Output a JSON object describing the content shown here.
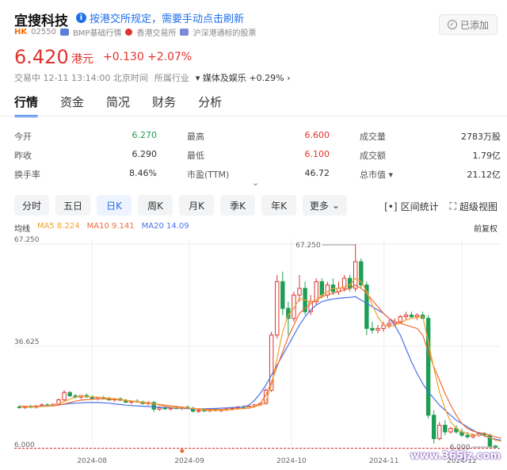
{
  "header": {
    "stock_name": "宜搜科技",
    "notice": "按港交所规定，需要手动点击刷新",
    "added_label": "已添加",
    "market": "HK",
    "code": "02550",
    "source_bmp": "BMP基础行情",
    "exchange": "香港交易所",
    "connect": "沪深港通标的股票"
  },
  "quote": {
    "price": "6.420",
    "unit": "港元",
    "change": "+0.130",
    "change_pct": "+2.07%",
    "status": "交易中 12-11 13:14:00 北京时间",
    "industry_label": "所属行业",
    "industry_name": "媒体及娱乐",
    "industry_change": "+0.29%"
  },
  "tabs": [
    "行情",
    "资金",
    "简况",
    "财务",
    "分析"
  ],
  "stats": [
    [
      {
        "label": "今开",
        "value": "6.270",
        "color": "green"
      },
      {
        "label": "最高",
        "value": "6.600",
        "color": "red"
      },
      {
        "label": "成交量",
        "value": "2783万股",
        "color": ""
      }
    ],
    [
      {
        "label": "昨收",
        "value": "6.290",
        "color": ""
      },
      {
        "label": "最低",
        "value": "6.100",
        "color": "red"
      },
      {
        "label": "成交额",
        "value": "1.79亿",
        "color": ""
      }
    ],
    [
      {
        "label": "换手率",
        "value": "8.46%",
        "color": ""
      },
      {
        "label": "市盈(TTM)",
        "value": "46.72",
        "color": ""
      },
      {
        "label": "总市值",
        "value": "21.12亿",
        "color": ""
      }
    ]
  ],
  "periods": [
    "分时",
    "五日",
    "日K",
    "周K",
    "月K",
    "季K",
    "年K",
    "更多"
  ],
  "active_period": "日K",
  "tools": {
    "range": "区间统计",
    "fullscreen": "超级视图"
  },
  "ma": {
    "label": "均线",
    "ma5": "MA5 8.224",
    "ma10": "MA10 9.141",
    "ma20": "MA20 14.09",
    "adjust": "前复权"
  },
  "colors": {
    "up": "#e0332c",
    "down": "#1e9e55",
    "ma5": "#f2a12e",
    "ma10": "#f06a3a",
    "ma20": "#4a72e8",
    "accent": "#1f6feb"
  },
  "watermark": "www.365jz.com",
  "chart_data": {
    "type": "candlestick",
    "y_ticks": [
      "67.250",
      "36.625",
      "6.000"
    ],
    "ylim": [
      6.0,
      67.25
    ],
    "x_ticks": [
      "2024-08",
      "2024-09",
      "2024-10",
      "2024-11",
      "2024-12"
    ],
    "high_label": "67.250",
    "low_label": "6.000",
    "candles": [
      [
        18.5,
        19.0,
        18.0,
        18.3
      ],
      [
        18.3,
        18.8,
        17.9,
        18.6
      ],
      [
        18.6,
        19.2,
        18.2,
        18.4
      ],
      [
        18.4,
        18.9,
        18.0,
        18.8
      ],
      [
        18.8,
        19.5,
        18.5,
        19.1
      ],
      [
        19.1,
        19.6,
        18.7,
        18.9
      ],
      [
        18.9,
        19.4,
        18.6,
        19.3
      ],
      [
        19.3,
        21.0,
        19.0,
        20.6
      ],
      [
        20.6,
        23.5,
        20.2,
        22.8
      ],
      [
        22.8,
        23.2,
        21.5,
        21.8
      ],
      [
        21.8,
        22.4,
        21.0,
        21.4
      ],
      [
        21.4,
        22.0,
        20.8,
        21.9
      ],
      [
        21.9,
        22.5,
        21.2,
        21.5
      ],
      [
        21.5,
        22.0,
        20.6,
        20.9
      ],
      [
        20.9,
        21.6,
        20.4,
        21.3
      ],
      [
        21.3,
        21.8,
        20.7,
        21.0
      ],
      [
        21.0,
        21.5,
        20.3,
        20.6
      ],
      [
        20.6,
        21.2,
        20.0,
        20.9
      ],
      [
        20.9,
        21.4,
        20.2,
        20.5
      ],
      [
        20.5,
        20.9,
        19.6,
        19.9
      ],
      [
        19.9,
        20.5,
        19.3,
        20.2
      ],
      [
        20.2,
        20.8,
        19.7,
        20.0
      ],
      [
        20.0,
        20.4,
        19.2,
        19.5
      ],
      [
        19.5,
        20.1,
        18.9,
        19.8
      ],
      [
        19.8,
        20.3,
        17.0,
        17.8
      ],
      [
        17.8,
        18.6,
        17.3,
        18.2
      ],
      [
        18.2,
        18.7,
        17.6,
        17.9
      ],
      [
        17.9,
        18.5,
        17.4,
        18.3
      ],
      [
        18.3,
        18.8,
        17.7,
        18.0
      ],
      [
        18.0,
        18.6,
        17.5,
        18.4
      ],
      [
        18.4,
        18.9,
        17.8,
        18.1
      ],
      [
        18.1,
        18.5,
        16.8,
        17.2
      ],
      [
        17.2,
        17.8,
        16.6,
        17.5
      ],
      [
        17.5,
        18.1,
        17.0,
        17.3
      ],
      [
        17.3,
        17.9,
        16.9,
        17.7
      ],
      [
        17.7,
        18.2,
        17.1,
        17.4
      ],
      [
        17.4,
        17.9,
        16.9,
        17.6
      ],
      [
        17.6,
        18.1,
        17.2,
        17.9
      ],
      [
        17.9,
        18.4,
        17.4,
        18.1
      ],
      [
        18.1,
        18.7,
        17.7,
        18.5
      ],
      [
        18.5,
        19.0,
        18.0,
        18.3
      ],
      [
        18.3,
        18.9,
        17.9,
        18.7
      ],
      [
        18.7,
        19.3,
        18.3,
        19.1
      ],
      [
        19.1,
        19.8,
        18.8,
        19.5
      ],
      [
        19.5,
        24.0,
        19.2,
        23.5
      ],
      [
        23.5,
        41.0,
        23.0,
        40.0
      ],
      [
        40.0,
        58.0,
        39.0,
        56.0
      ],
      [
        56.0,
        59.0,
        46.0,
        48.0
      ],
      [
        48.0,
        50.0,
        40.0,
        45.0
      ],
      [
        45.0,
        53.0,
        44.0,
        52.0
      ],
      [
        52.0,
        58.0,
        50.0,
        54.0
      ],
      [
        54.0,
        56.0,
        46.0,
        47.0
      ],
      [
        47.0,
        52.0,
        46.0,
        50.0
      ],
      [
        50.0,
        57.0,
        49.0,
        56.0
      ],
      [
        56.0,
        57.0,
        51.0,
        52.0
      ],
      [
        52.0,
        56.0,
        51.0,
        55.0
      ],
      [
        55.0,
        57.0,
        52.0,
        53.0
      ],
      [
        53.0,
        56.0,
        52.0,
        54.0
      ],
      [
        54.0,
        58.0,
        53.0,
        57.0
      ],
      [
        57.0,
        58.0,
        53.0,
        54.0
      ],
      [
        54.0,
        67.25,
        53.0,
        62.0
      ],
      [
        62.0,
        63.0,
        54.0,
        55.0
      ],
      [
        55.0,
        56.0,
        40.0,
        42.0
      ],
      [
        42.0,
        44.0,
        40.5,
        41.5
      ],
      [
        41.5,
        43.0,
        40.5,
        42.0
      ],
      [
        42.0,
        44.0,
        41.0,
        43.0
      ],
      [
        43.0,
        44.5,
        42.0,
        43.5
      ],
      [
        43.5,
        45.0,
        42.5,
        44.0
      ],
      [
        44.0,
        46.0,
        43.5,
        45.5
      ],
      [
        45.5,
        47.0,
        44.5,
        46.0
      ],
      [
        46.0,
        47.0,
        45.0,
        45.5
      ],
      [
        45.5,
        46.5,
        44.5,
        46.0
      ],
      [
        46.0,
        47.0,
        45.0,
        45.0
      ],
      [
        45.0,
        46.0,
        15.0,
        16.0
      ],
      [
        16.0,
        17.5,
        7.5,
        9.0
      ],
      [
        9.0,
        14.0,
        8.5,
        13.0
      ],
      [
        13.0,
        14.5,
        10.0,
        11.0
      ],
      [
        11.0,
        12.5,
        10.5,
        12.0
      ],
      [
        12.0,
        13.0,
        10.5,
        11.0
      ],
      [
        11.0,
        12.0,
        9.5,
        10.0
      ],
      [
        10.0,
        11.0,
        9.0,
        9.5
      ],
      [
        9.5,
        10.5,
        9.0,
        10.0
      ],
      [
        10.0,
        11.0,
        9.5,
        10.5
      ],
      [
        10.5,
        11.0,
        9.5,
        10.0
      ],
      [
        10.0,
        10.5,
        6.2,
        6.8
      ],
      [
        6.8,
        7.0,
        6.0,
        6.42
      ]
    ],
    "ma20_line": [
      18.6,
      18.6,
      18.6,
      18.6,
      18.7,
      18.8,
      18.9,
      19.1,
      19.3,
      19.5,
      19.6,
      19.7,
      19.8,
      19.8,
      19.8,
      19.7,
      19.6,
      19.4,
      19.2,
      19.0,
      18.9,
      18.8,
      18.7,
      18.6,
      18.5,
      18.4,
      18.3,
      18.2,
      18.1,
      18.0,
      18.0,
      17.9,
      17.9,
      17.9,
      18.0,
      18.0,
      18.1,
      18.2,
      18.3,
      18.4,
      18.5,
      19.0,
      20.5,
      22.5,
      25.0,
      28.0,
      31.0,
      34.0,
      37.0,
      40.0,
      43.0,
      45.5,
      47.5,
      49.0,
      50.0,
      50.5,
      50.8,
      51.0,
      51.2,
      51.3,
      51.5,
      50.5,
      49.5,
      48.5,
      47.5,
      46.5,
      45.0,
      43.0,
      40.0,
      36.0,
      32.0,
      28.5,
      25.5,
      23.0,
      21.0,
      19.0,
      17.5,
      16.0,
      14.5,
      13.5,
      12.5,
      11.5,
      10.6,
      9.8,
      9.2,
      8.8,
      8.5
    ],
    "ma5_line": [
      18.6,
      18.5,
      18.5,
      18.5,
      18.6,
      18.8,
      18.9,
      19.4,
      20.1,
      20.8,
      21.4,
      21.8,
      21.6,
      21.5,
      21.4,
      21.3,
      21.1,
      20.9,
      20.7,
      20.5,
      20.3,
      20.1,
      19.9,
      19.7,
      19.4,
      19.0,
      18.7,
      18.4,
      18.2,
      18.1,
      18.2,
      18.0,
      17.8,
      17.6,
      17.4,
      17.4,
      17.5,
      17.6,
      17.7,
      17.9,
      18.1,
      18.3,
      18.6,
      19.0,
      20.0,
      25.0,
      33.0,
      41.0,
      46.0,
      48.0,
      51.0,
      50.5,
      50.0,
      50.5,
      52.0,
      53.0,
      54.0,
      54.0,
      54.5,
      55.0,
      57.0,
      56.0,
      53.0,
      49.0,
      45.5,
      43.0,
      42.5,
      43.0,
      43.5,
      44.5,
      45.0,
      45.3,
      45.6,
      38.0,
      30.0,
      23.0,
      18.0,
      14.0,
      12.0,
      11.0,
      10.5,
      10.2,
      10.0,
      10.0,
      9.3,
      8.5,
      8.2
    ],
    "ma10_line": [
      18.7,
      18.7,
      18.6,
      18.6,
      18.6,
      18.7,
      18.8,
      19.0,
      19.4,
      19.8,
      20.2,
      20.5,
      20.7,
      20.8,
      20.9,
      20.9,
      20.8,
      20.7,
      20.6,
      20.4,
      20.2,
      20.0,
      19.8,
      19.6,
      19.4,
      19.2,
      19.0,
      18.8,
      18.6,
      18.4,
      18.2,
      18.0,
      17.9,
      17.8,
      17.7,
      17.7,
      17.7,
      17.8,
      17.8,
      17.9,
      18.0,
      18.2,
      18.5,
      19.5,
      22.0,
      26.0,
      30.5,
      35.0,
      39.5,
      43.0,
      46.5,
      48.0,
      49.5,
      50.5,
      51.5,
      52.0,
      52.5,
      53.0,
      53.5,
      54.0,
      55.0,
      54.0,
      52.5,
      50.5,
      48.5,
      46.5,
      45.0,
      44.0,
      43.5,
      43.0,
      42.5,
      42.0,
      40.0,
      35.0,
      30.5,
      26.5,
      22.5,
      19.0,
      16.0,
      13.5,
      12.0,
      11.2,
      10.8,
      10.5,
      10.0,
      9.5,
      9.1
    ]
  }
}
